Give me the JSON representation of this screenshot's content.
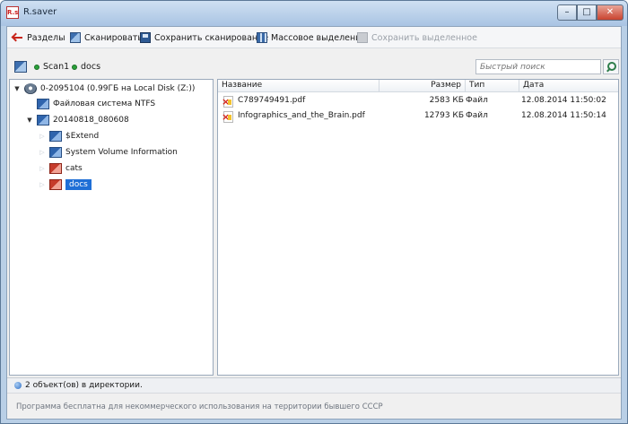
{
  "window": {
    "title": "R.saver",
    "logo_text": "R.s",
    "controls": {
      "minimize": "–",
      "maximize": "□",
      "close": "✕"
    }
  },
  "toolbar": {
    "partitions": "Разделы",
    "scan": "Сканировать",
    "save_scan": "Сохранить сканирование",
    "mass_select": "Массовое выделение",
    "save_selected": "Сохранить выделенное"
  },
  "address": {
    "crumbs": [
      "Scan1",
      "docs"
    ],
    "search_placeholder": "Быстрый поиск"
  },
  "tree": [
    {
      "label": "0-2095104 (0.99ГБ на Local Disk (Z:))",
      "expander": "▼",
      "icon": "disk-icon"
    },
    {
      "label": "Файловая система NTFS",
      "expander": "",
      "icon": "folder-icon"
    },
    {
      "label": "20140818_080608",
      "expander": "▼",
      "icon": "folder-icon"
    },
    {
      "label": "$Extend",
      "expander": "▷",
      "icon": "folder-icon"
    },
    {
      "label": "System Volume Information",
      "expander": "▷",
      "icon": "folder-icon"
    },
    {
      "label": "cats",
      "expander": "▷",
      "icon": "red-folder-icon"
    },
    {
      "label": "docs",
      "expander": "▷",
      "icon": "red-folder-icon",
      "selected": true
    }
  ],
  "list": {
    "columns": {
      "name": "Название",
      "size": "Размер",
      "type": "Тип",
      "date": "Дата"
    },
    "rows": [
      {
        "name": "C789749491.pdf",
        "size": "2583 КБ",
        "type": "Файл",
        "date": "12.08.2014 11:50:02"
      },
      {
        "name": "Infographics_and_the_Brain.pdf",
        "size": "12793 КБ",
        "type": "Файл",
        "date": "12.08.2014 11:50:14"
      }
    ]
  },
  "status": {
    "text": "2 объект(ов) в директории."
  },
  "footer": {
    "text": "Программа бесплатна для некоммерческого использования на территории бывшего СССР"
  },
  "colors": {
    "selection": "#1f6fd6",
    "frame": "#b9cfe6",
    "pdf_mark": "#d4201a"
  }
}
